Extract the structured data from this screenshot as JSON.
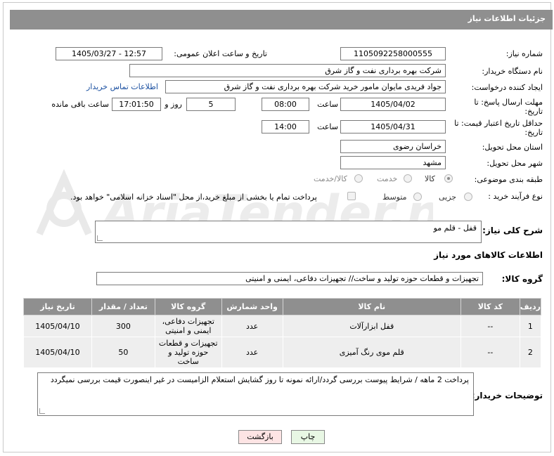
{
  "header": {
    "title": "جزئیات اطلاعات نیاز"
  },
  "fields": {
    "need_number_label": "شماره نیاز:",
    "need_number": "1105092258000555",
    "announce_label": "تاریخ و ساعت اعلان عمومی:",
    "announce_value": "1405/03/27 - 12:57",
    "buyer_org_label": "نام دستگاه خریدار:",
    "buyer_org": "شرکت بهره برداری نفت و گاز شرق",
    "creator_label": "ایجاد کننده درخواست:",
    "creator": "جواد فریدی مایوان مامور خرید شرکت بهره برداری نفت و گاز شرق",
    "buyer_contact_link": "اطلاعات تماس خریدار",
    "send_deadline_label": "مهلت ارسال پاسخ: تا تاریخ:",
    "send_date": "1405/04/02",
    "time_label": "ساعت",
    "send_time": "08:00",
    "days_value": "5",
    "days_label": "روز و",
    "remaining_time": "17:01:50",
    "remaining_label": "ساعت باقی مانده",
    "validity_label": "حداقل تاریخ اعتبار قیمت: تا تاریخ:",
    "validity_date": "1405/04/31",
    "validity_time": "14:00",
    "province_label": "استان محل تحویل:",
    "province": "خراسان رضوی",
    "city_label": "شهر محل تحویل:",
    "city": "مشهد",
    "category_label": "طبقه بندی موضوعی:",
    "category_options": [
      "کالا",
      "خدمت",
      "کالا/خدمت"
    ],
    "category_selected": "کالا",
    "process_label": "نوع فرآیند خرید :",
    "process_options": [
      "جزیی",
      "متوسط"
    ],
    "payment_note": "پرداخت تمام یا بخشی از مبلغ خرید،از محل \"اسناد خزانه اسلامی\" خواهد بود.",
    "summary_label": "شرح کلی نیاز:",
    "summary": "قفل - قلم مو",
    "goods_info_label": "اطلاعات کالاهای مورد نیاز",
    "goods_group_label": "گروه کالا:",
    "goods_group": "تجهیزات و قطعات حوزه تولید و ساخت// تجهیزات دفاعی، ایمنی و امنیتی"
  },
  "table": {
    "headers": [
      "ردیف",
      "کد کالا",
      "نام کالا",
      "واحد شمارش",
      "گروه کالا",
      "تعداد / مقدار",
      "تاریخ نیاز"
    ],
    "rows": [
      [
        "1",
        "--",
        "قفل ابزارآلات",
        "عدد",
        "تجهیزات دفاعی، ایمنی و امنیتی",
        "300",
        "1405/04/10"
      ],
      [
        "2",
        "--",
        "قلم موی رنگ آمیزی",
        "عدد",
        "تجهیزات و قطعات حوزه تولید و ساخت",
        "50",
        "1405/04/10"
      ]
    ]
  },
  "buyer_notes_label": "توضیحات خریدار:",
  "buyer_notes": "پرداخت 2 ماهه / شرایط پیوست بررسی گردد/ارائه نمونه تا روز گشایش استعلام الزامیست در غیر اینصورت قیمت بررسی نمیگردد",
  "buttons": {
    "print": "چاپ",
    "back": "بازگشت"
  },
  "watermark_text": "AriaTender.neT",
  "colors": {
    "header_bg": "#8f8f8f",
    "link": "#1a4fa0",
    "print_btn": "#e8f7e4",
    "back_btn": "#fde4e4"
  }
}
